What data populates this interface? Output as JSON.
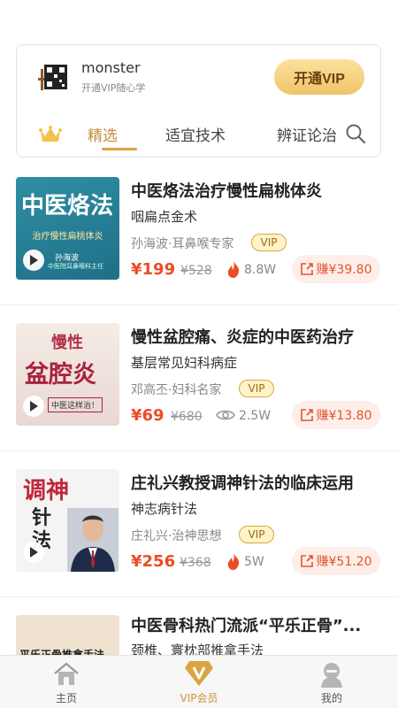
{
  "header": {
    "username": "monster",
    "subtitle": "开通VIP随心学",
    "vip_button": "开通VIP"
  },
  "tabs": [
    {
      "label": "精选",
      "active": true
    },
    {
      "label": "适宜技术",
      "active": false
    },
    {
      "label": "辨证论治",
      "active": false
    }
  ],
  "courses": [
    {
      "title": "中医烙法治疗慢性扁桃体炎",
      "subtitle": "咽扁点金术",
      "author": "孙海波·耳鼻喉专家",
      "badge": "VIP",
      "price": "¥199",
      "old_price": "¥528",
      "heat": "8.8W",
      "heat_icon": "flame-icon",
      "earn": "赚¥39.80",
      "thumb": {
        "line1": "中医烙法",
        "line2": "治疗慢性扁桃体炎",
        "line3": "孙海波",
        "line4": "中医院耳鼻喉科主任"
      }
    },
    {
      "title": "慢性盆腔痛、炎症的中医药治疗",
      "subtitle": "基层常见妇科病症",
      "author": "邓高丕·妇科名家",
      "badge": "VIP",
      "price": "¥69",
      "old_price": "¥680",
      "heat": "2.5W",
      "heat_icon": "eye-icon",
      "earn": "赚¥13.80",
      "thumb": {
        "line1": "慢性",
        "line2": "盆腔炎",
        "line3": "中医这样治！"
      }
    },
    {
      "title": "庄礼兴教授调神针法的临床运用",
      "subtitle": "神志病针法",
      "author": "庄礼兴·治神思想",
      "badge": "VIP",
      "price": "¥256",
      "old_price": "¥368",
      "heat": "5W",
      "heat_icon": "flame-icon",
      "earn": "赚¥51.20",
      "thumb": {
        "line1": "调神",
        "line2": "针法"
      }
    },
    {
      "title": "中医骨科热门流派“平乐正骨”...",
      "subtitle": "颈椎、寰枕部推拿手法",
      "thumb": {
        "line1": "平乐正骨推拿手法"
      }
    }
  ],
  "tabbar": [
    {
      "label": "主页",
      "icon": "home-icon",
      "active": false
    },
    {
      "label": "VIP会员",
      "icon": "vip-icon",
      "active": true
    },
    {
      "label": "我的",
      "icon": "profile-icon",
      "active": false
    }
  ],
  "colors": {
    "accent": "#c28f3a",
    "price": "#ec4c24",
    "vip_gold": "#f1c46a"
  }
}
